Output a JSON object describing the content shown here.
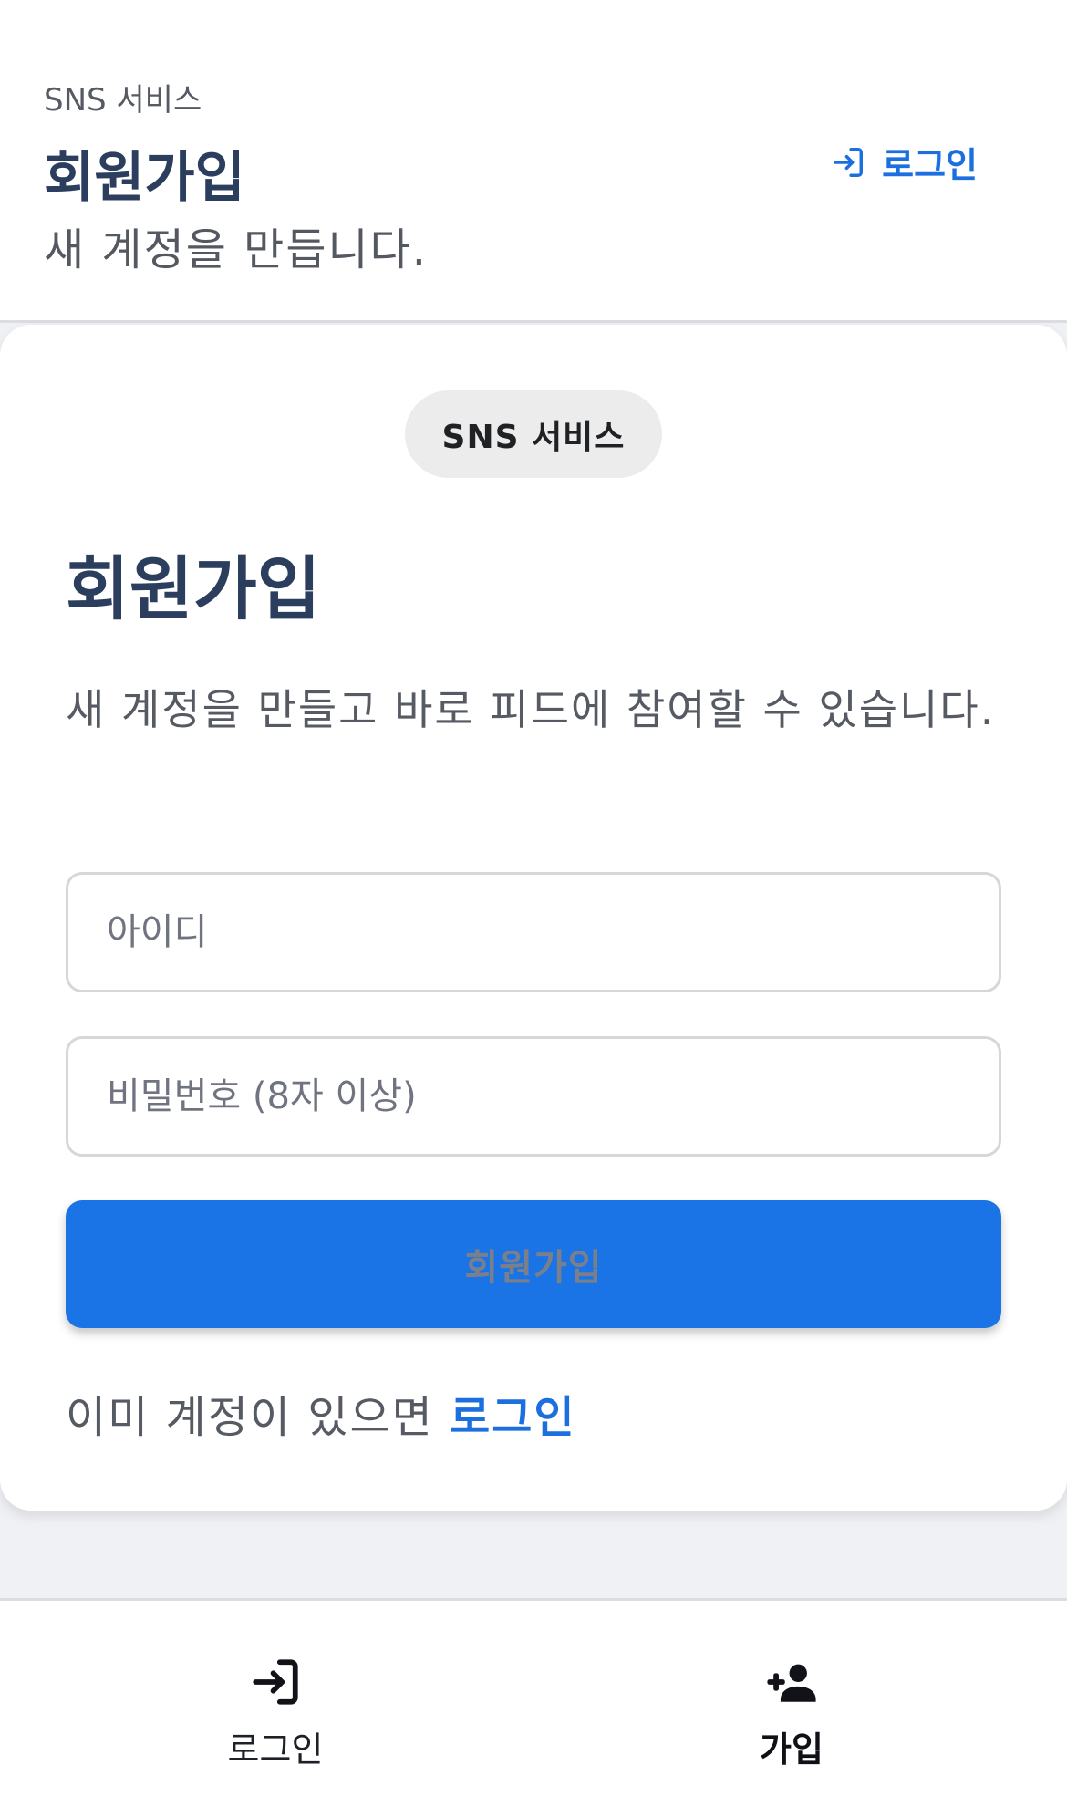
{
  "header": {
    "app_name": "SNS 서비스",
    "title": "회원가입",
    "subtitle": "새 계정을 만듭니다.",
    "login_link_label": "로그인",
    "login_icon": "login-arrow-icon"
  },
  "card": {
    "badge": "SNS 서비스",
    "title": "회원가입",
    "description": "새 계정을 만들고 바로 피드에 참여할 수 있습니다.",
    "id_field": {
      "value": "",
      "placeholder": "아이디"
    },
    "password_field": {
      "value": "",
      "placeholder": "비밀번호 (8자 이상)"
    },
    "submit_label": "회원가입",
    "already_text": "이미 계정이 있으면",
    "login_link": "로그인"
  },
  "bottom_nav": {
    "items": [
      {
        "label": "로그인",
        "icon": "login-icon",
        "active": false
      },
      {
        "label": "가입",
        "icon": "person-add-icon",
        "active": true
      }
    ]
  },
  "colors": {
    "accent": "#1b74e6",
    "title": "#2c3e5e",
    "background": "#f0f1f4"
  }
}
